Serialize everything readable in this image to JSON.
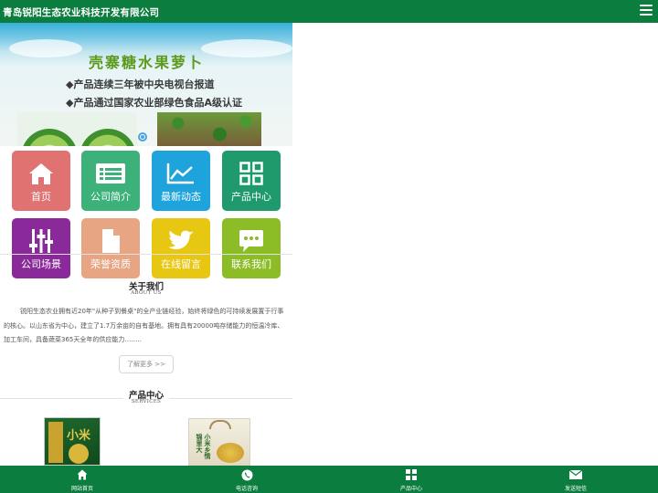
{
  "header": {
    "title": "青岛锐阳生态农业科技开发有限公司",
    "menu_icon": "hamburger-menu-icon"
  },
  "banner": {
    "headline": "壳寨糖水果萝卜",
    "bullets": [
      "◆产品连续三年被中央电视台报道",
      "◆产品通过国家农业部绿色食品A级认证"
    ]
  },
  "tiles": [
    {
      "label": "首页",
      "icon": "home-icon",
      "color": "#e07272"
    },
    {
      "label": "公司简介",
      "icon": "id-card-icon",
      "color": "#3cb17a"
    },
    {
      "label": "最新动态",
      "icon": "line-chart-icon",
      "color": "#1ea3dc"
    },
    {
      "label": "产品中心",
      "icon": "grid-icon",
      "color": "#1e9a6c"
    },
    {
      "label": "公司场景",
      "icon": "sliders-icon",
      "color": "#8a2a9a"
    },
    {
      "label": "荣誉资质",
      "icon": "document-icon",
      "color": "#e8a583"
    },
    {
      "label": "在线留言",
      "icon": "twitter-bird-icon",
      "color": "#e8c712"
    },
    {
      "label": "联系我们",
      "icon": "chat-bubble-icon",
      "color": "#8cbc26"
    }
  ],
  "about": {
    "title": "关于我们",
    "subtitle": "ABOUT US",
    "text": "锐阳生态农业拥有近20年\"从种子到餐桌\"的全产业链经验，始终将绿色的可持续发展置于行事的核心。以山东省为中心，建立了1.7万余亩的自有基地。拥有具有20000吨存储能力的恒温冷库、加工车间，具备蔬菜365天全年的供应能力……..",
    "more": "了解更多 >>"
  },
  "products": {
    "title": "产品中心",
    "subtitle": "SERVICES",
    "product_texts": [
      "小米",
      "小米乡情 锦里大"
    ]
  },
  "bottom_nav": [
    {
      "label": "网站首页",
      "icon": "home-icon"
    },
    {
      "label": "电话咨询",
      "icon": "phone-icon"
    },
    {
      "label": "产品中心",
      "icon": "grid-icon"
    },
    {
      "label": "发送短信",
      "icon": "mail-icon"
    }
  ],
  "colors": {
    "brand": "#0b7d3e"
  }
}
